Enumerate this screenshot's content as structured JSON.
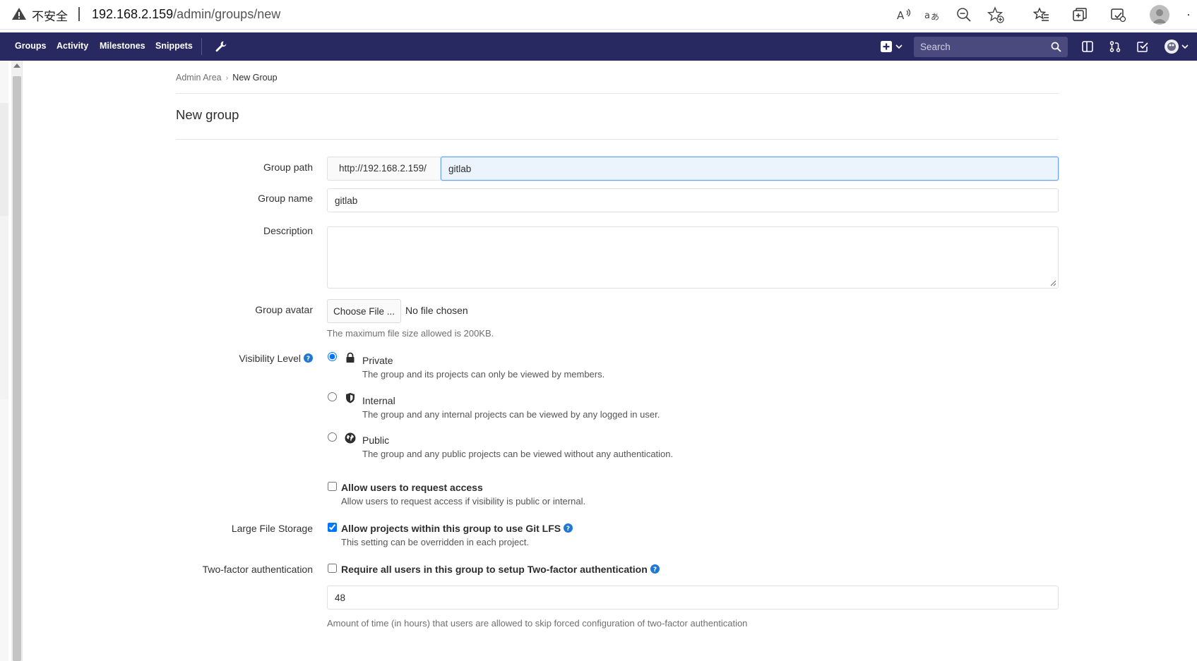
{
  "browser": {
    "insecure_label": "不安全",
    "url_host": "192.168.2.159",
    "url_path": "/admin/groups/new"
  },
  "navbar": {
    "links": [
      "Groups",
      "Activity",
      "Milestones",
      "Snippets"
    ],
    "search_placeholder": "Search"
  },
  "breadcrumb": {
    "parent": "Admin Area",
    "current": "New Group"
  },
  "page": {
    "title": "New group"
  },
  "form": {
    "group_path": {
      "label": "Group path",
      "prefix": "http://192.168.2.159/",
      "value": "gitlab"
    },
    "group_name": {
      "label": "Group name",
      "value": "gitlab"
    },
    "description": {
      "label": "Description",
      "value": ""
    },
    "avatar": {
      "label": "Group avatar",
      "button": "Choose File ...",
      "status": "No file chosen",
      "help": "The maximum file size allowed is 200KB."
    },
    "visibility": {
      "label": "Visibility Level",
      "options": [
        {
          "title": "Private",
          "description": "The group and its projects can only be viewed by members.",
          "icon": "lock-icon",
          "selected": true
        },
        {
          "title": "Internal",
          "description": "The group and any internal projects can be viewed by any logged in user.",
          "icon": "shield-icon",
          "selected": false
        },
        {
          "title": "Public",
          "description": "The group and any public projects can be viewed without any authentication.",
          "icon": "globe-icon",
          "selected": false
        }
      ]
    },
    "request_access": {
      "label": "Allow users to request access",
      "description": "Allow users to request access if visibility is public or internal.",
      "checked": false
    },
    "lfs": {
      "section_label": "Large File Storage",
      "label": "Allow projects within this group to use Git LFS",
      "description": "This setting can be overridden in each project.",
      "checked": true
    },
    "two_factor": {
      "section_label": "Two-factor authentication",
      "label": "Require all users in this group to setup Two-factor authentication",
      "checked": false,
      "grace_value": "48",
      "grace_help": "Amount of time (in hours) that users are allowed to skip forced configuration of two-factor authentication"
    }
  },
  "colors": {
    "navbar": "#292961",
    "search_bg": "#4a4a7f",
    "focus_border": "#6ba4ea",
    "help_icon": "#1f78d1"
  }
}
